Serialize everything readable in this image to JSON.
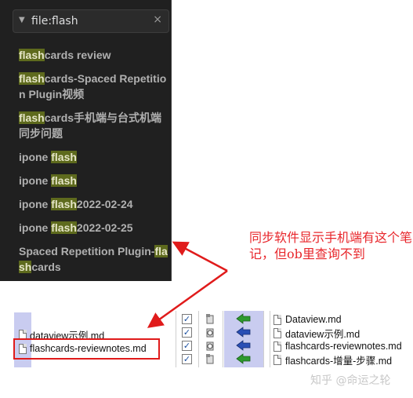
{
  "search": {
    "query": "file:flash",
    "caret": "▼",
    "clear": "×"
  },
  "results": [
    {
      "hl": "flash",
      "rest": "cards review"
    },
    {
      "hl": "flash",
      "rest": "cards-Spaced Repetition Plugin视频"
    },
    {
      "hl": "flash",
      "rest": "cards手机端与台式机端同步问题"
    },
    {
      "pre": "ipone ",
      "hl": "flash"
    },
    {
      "pre": "ipone ",
      "hl": "flash"
    },
    {
      "pre": "ipone ",
      "hl": "flash",
      "rest": "2022-02-24"
    },
    {
      "pre": "ipone ",
      "hl": "flash",
      "rest": "2022-02-25"
    },
    {
      "pre": "Spaced Repetition Plugin-",
      "hl": "flash",
      "rest": "cards"
    }
  ],
  "annotation": "同步软件显示手机端有这个笔记，但ob里查询不到",
  "left_files": [
    "dataview示例.md",
    "flashcards-reviewnotes.md"
  ],
  "right_files": [
    "Dataview.md",
    "dataview示例.md",
    "flashcards-reviewnotes.md",
    "flashcards-增量-步骤.md"
  ],
  "checkbox_mark": "✓",
  "colors": {
    "highlight": "#5e6a1d",
    "annotation": "#e8262b",
    "action_column": "#c9ccf0",
    "arrow_green": "#2e9a2e",
    "arrow_blue": "#2a4fb5"
  },
  "icons": {
    "search_caret": "triangle-down-icon",
    "clear": "close-icon",
    "file": "document-icon",
    "add": "green-add-arrow-icon",
    "sync": "blue-left-arrow-icon"
  },
  "watermark": "知乎 @命运之轮"
}
